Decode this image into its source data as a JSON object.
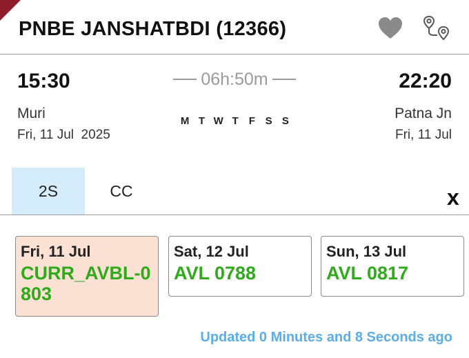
{
  "colors": {
    "ribbon": "#8f1d2c",
    "selected_tab_bg": "#d5ecfa",
    "selected_card_bg": "#fbe0d4",
    "status_green": "#2eaa1a",
    "updated_blue": "#5aaee8",
    "icon_grey": "#8a8a8a"
  },
  "header": {
    "title": "PNBE JANSHATBDI (12366)",
    "favorite_icon": "heart-icon",
    "route_icon": "route-map-icon"
  },
  "journey": {
    "departure": {
      "time": "15:30",
      "station": "Muri",
      "date": "Fri, 11 Jul  2025"
    },
    "arrival": {
      "time": "22:20",
      "station": "Patna Jn",
      "date": "Fri, 11 Jul"
    },
    "duration": "06h:50m",
    "run_days": [
      "M",
      "T",
      "W",
      "T",
      "F",
      "S",
      "S"
    ]
  },
  "classes": {
    "tabs": [
      {
        "label": "2S",
        "selected": true
      },
      {
        "label": "CC",
        "selected": false
      }
    ],
    "close_label": "x"
  },
  "availability": [
    {
      "date": "Fri, 11 Jul",
      "status": "CURR_AVBL-0803",
      "selected": true
    },
    {
      "date": "Sat, 12 Jul",
      "status": "AVL 0788",
      "selected": false
    },
    {
      "date": "Sun, 13 Jul",
      "status": "AVL 0817",
      "selected": false
    }
  ],
  "updated_text": "Updated 0 Minutes and 8 Seconds ago"
}
